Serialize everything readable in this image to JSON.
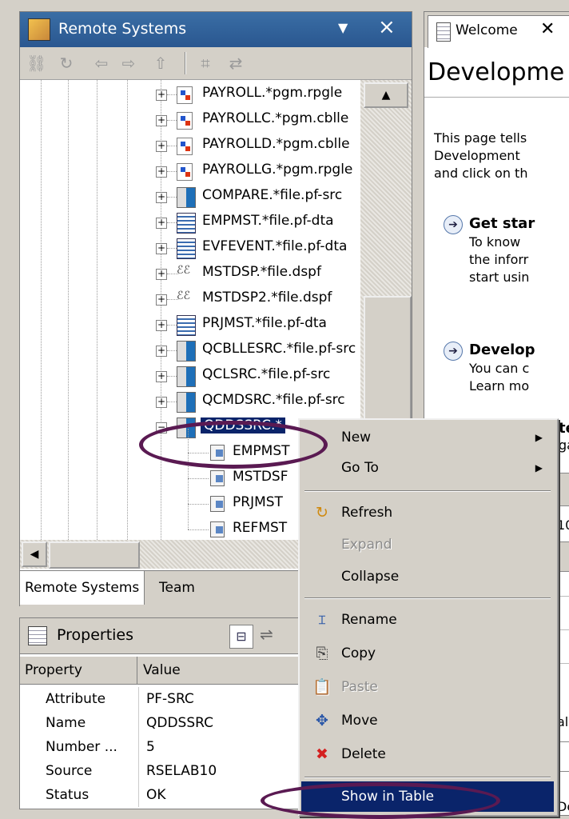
{
  "remote_systems": {
    "title": "Remote Systems",
    "minimize_glyph": "▼",
    "close_glyph": "×",
    "toolbar_icons": [
      "link-icon",
      "refresh-icon",
      "back-icon",
      "forward-icon",
      "up-icon",
      "collapse-all-icon",
      "link-editor-icon"
    ],
    "tree": [
      {
        "label": "PAYROLL.*pgm.rpgle",
        "icon": "program-icon",
        "expander": "+"
      },
      {
        "label": "PAYROLLC.*pgm.cblle",
        "icon": "program-icon",
        "expander": "+"
      },
      {
        "label": "PAYROLLD.*pgm.cblle",
        "icon": "program-icon",
        "expander": "+"
      },
      {
        "label": "PAYROLLG.*pgm.rpgle",
        "icon": "program-icon",
        "expander": "+"
      },
      {
        "label": "COMPARE.*file.pf-src",
        "icon": "source-file-icon",
        "expander": "+"
      },
      {
        "label": "EMPMST.*file.pf-dta",
        "icon": "data-file-icon",
        "expander": "+"
      },
      {
        "label": "EVFEVENT.*file.pf-dta",
        "icon": "data-file-icon",
        "expander": "+"
      },
      {
        "label": "MSTDSP.*file.dspf",
        "icon": "display-file-icon",
        "expander": "+"
      },
      {
        "label": "MSTDSP2.*file.dspf",
        "icon": "display-file-icon",
        "expander": "+"
      },
      {
        "label": "PRJMST.*file.pf-dta",
        "icon": "data-file-icon",
        "expander": "+"
      },
      {
        "label": "QCBLLESRC.*file.pf-src",
        "icon": "source-file-icon",
        "expander": "+"
      },
      {
        "label": "QCLSRC.*file.pf-src",
        "icon": "source-file-icon",
        "expander": "+"
      },
      {
        "label": "QCMDSRC.*file.pf-src",
        "icon": "source-file-icon",
        "expander": "+"
      },
      {
        "label": "QDDSSRC.*",
        "icon": "source-file-icon",
        "expander": "−",
        "selected": true
      }
    ],
    "members": [
      "EMPMST",
      "MSTDSF",
      "PRJMST",
      "REFMST"
    ],
    "bottom_tabs": [
      "Remote Systems",
      "Team"
    ]
  },
  "properties": {
    "title": "Properties",
    "columns": [
      "Property",
      "Value"
    ],
    "rows": [
      {
        "property": "Attribute",
        "value": "PF-SRC"
      },
      {
        "property": "Name",
        "value": "QDDSSRC"
      },
      {
        "property": "Number ...",
        "value": "5"
      },
      {
        "property": "Source",
        "value": "RSELAB10"
      },
      {
        "property": "Status",
        "value": "OK"
      }
    ]
  },
  "welcome": {
    "tab_label": "Welcome",
    "close_glyph": "✕",
    "heading": "Developme",
    "intro_lines": [
      "This page tells",
      "Development",
      "and click on th"
    ],
    "sections": [
      {
        "title": "Get star",
        "lines": [
          "To know",
          "the inforr",
          "start usin"
        ]
      },
      {
        "title": "Develop",
        "lines": [
          "You can c",
          "Learn mo"
        ]
      }
    ],
    "fragments": [
      "te",
      "ga",
      "10",
      "al",
      "De"
    ]
  },
  "context_menu": {
    "items": [
      {
        "label": "New",
        "submenu": true,
        "icon": ""
      },
      {
        "label": "Go To",
        "submenu": true,
        "icon": ""
      },
      {
        "label": "Refresh",
        "icon": "refresh-icon"
      },
      {
        "label": "Expand",
        "disabled": true,
        "icon": ""
      },
      {
        "label": "Collapse",
        "icon": ""
      },
      {
        "label": "Rename",
        "icon": "rename-icon"
      },
      {
        "label": "Copy",
        "icon": "copy-icon"
      },
      {
        "label": "Paste",
        "disabled": true,
        "icon": "paste-icon"
      },
      {
        "label": "Move",
        "icon": "move-icon"
      },
      {
        "label": "Delete",
        "icon": "delete-icon"
      },
      {
        "label": "Show in Table",
        "highlighted": true,
        "icon": ""
      }
    ]
  },
  "colors": {
    "selection": "#0a246a",
    "annotation": "#5a1a52",
    "title_bar": "#3a6ea5"
  }
}
